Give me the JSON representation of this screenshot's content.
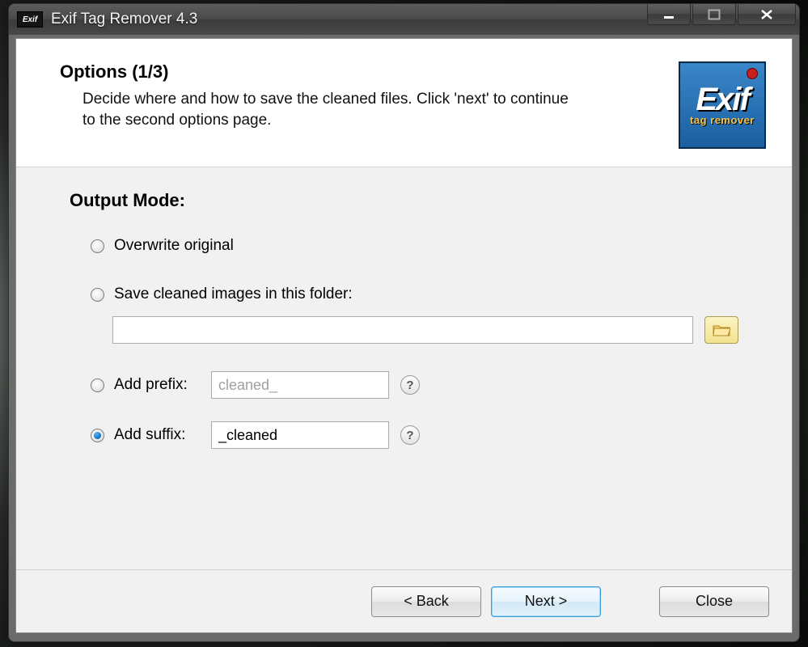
{
  "window": {
    "title": "Exif Tag Remover 4.3",
    "app_icon_text": "Exif"
  },
  "header": {
    "title": "Options (1/3)",
    "description": "Decide where and how to save the cleaned files. Click 'next' to continue to the second options page."
  },
  "brand": {
    "big": "Exif",
    "small": "tag remover"
  },
  "section": {
    "label": "Output Mode:"
  },
  "options": {
    "overwrite_label": "Overwrite original",
    "savefolder_label": "Save cleaned images in this folder:",
    "folder_value": "",
    "prefix_label": "Add prefix:",
    "prefix_value": "cleaned_",
    "suffix_label": "Add suffix:",
    "suffix_value": "_cleaned",
    "selected": "suffix"
  },
  "help_glyph": "?",
  "buttons": {
    "back": "< Back",
    "next": "Next >",
    "close": "Close"
  }
}
